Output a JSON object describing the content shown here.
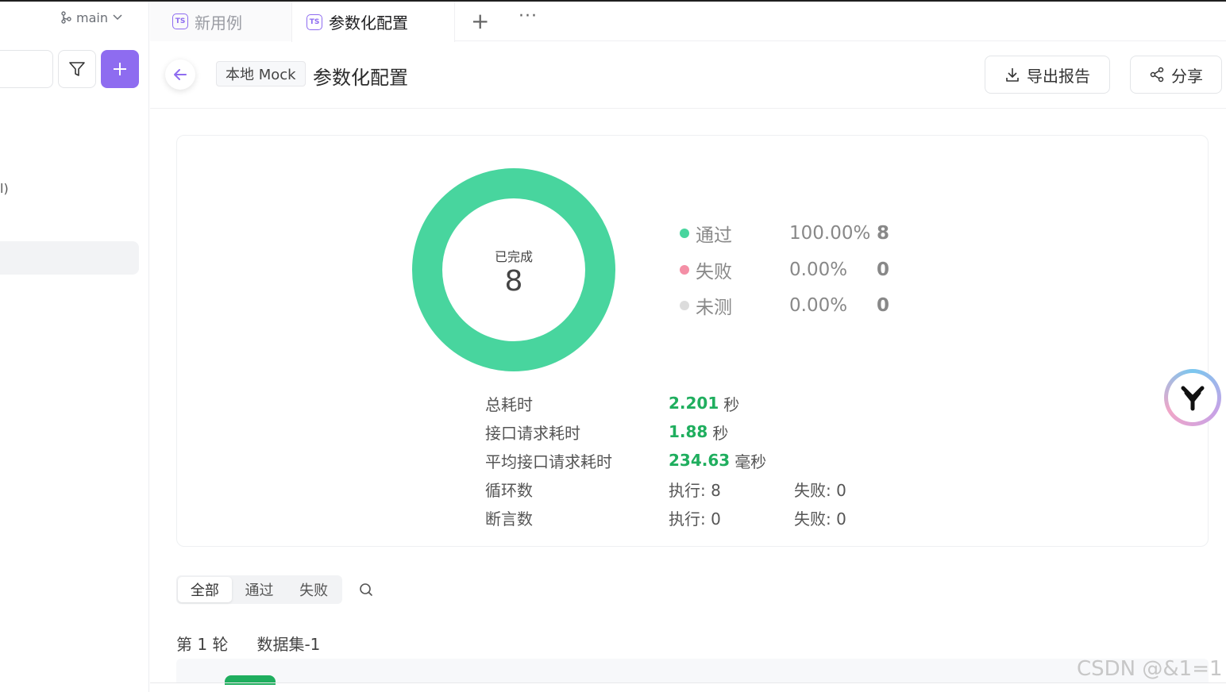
{
  "sidebar": {
    "branch": "main",
    "fragment_text": "l)"
  },
  "tabs": [
    {
      "label": "新用例",
      "icon": "ts"
    },
    {
      "label": "参数化配置",
      "icon": "ts"
    }
  ],
  "tab_actions": {
    "add": "+",
    "more": "···"
  },
  "header": {
    "env_tag": "本地 Mock",
    "title": "参数化配置",
    "export_label": "导出报告",
    "share_label": "分享"
  },
  "summary": {
    "center_label": "已完成",
    "center_value": "8",
    "legend": [
      {
        "name": "通过",
        "pct": "100.00%",
        "count": "8",
        "color": "#48d59e"
      },
      {
        "name": "失败",
        "pct": "0.00%",
        "count": "0",
        "color": "#f48fa6"
      },
      {
        "name": "未测",
        "pct": "0.00%",
        "count": "0",
        "color": "#dcdcdc"
      }
    ],
    "stats": [
      {
        "label": "总耗时",
        "value": "2.201",
        "unit": "秒"
      },
      {
        "label": "接口请求耗时",
        "value": "1.88",
        "unit": "秒"
      },
      {
        "label": "平均接口请求耗时",
        "value": "234.63",
        "unit": "毫秒"
      }
    ],
    "loops": {
      "label": "循环数",
      "exec": "执行: 8",
      "fail": "失败: 0"
    },
    "asserts": {
      "label": "断言数",
      "exec": "执行: 0",
      "fail": "失败: 0"
    }
  },
  "filter": {
    "options": [
      "全部",
      "通过",
      "失败"
    ],
    "active": "全部"
  },
  "round": {
    "label": "第 1 轮",
    "dataset": "数据集-1"
  },
  "watermark": "CSDN @&1=1",
  "colors": {
    "accent": "#8e6cf0",
    "success": "#1fae5e",
    "donut": "#48d59e"
  }
}
